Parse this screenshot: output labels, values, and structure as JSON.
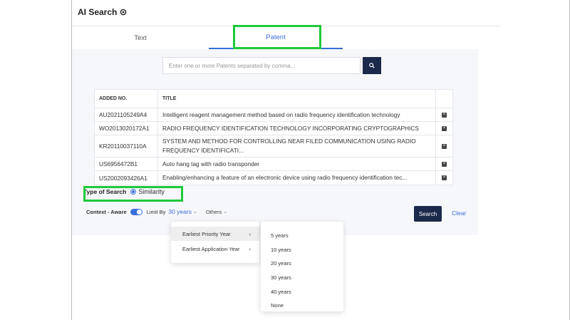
{
  "app": {
    "title": "AI Search"
  },
  "tabs": [
    {
      "label": "Text"
    },
    {
      "label": "Patent"
    }
  ],
  "search": {
    "placeholder": "Enter one or more Patents separated by comma..."
  },
  "table": {
    "headers": [
      "ADDED NO.",
      "TITLE"
    ],
    "rows": [
      {
        "no": "AU2021105249A4",
        "title": "Intelligent reagent management method based on radio frequency identification technology"
      },
      {
        "no": "WO2013020172A1",
        "title": "RADIO FREQUENCY IDENTIFICATION TECHNOLOGY INCORPORATING CRYPTOGRAPHICS"
      },
      {
        "no": "KR20110037110A",
        "title": "SYSTEM AND METHOD FOR CONTROLLING NEAR FILED COMMUNICATION USING RADIO FREQUENCY IDENTIFICATI..."
      },
      {
        "no": "US6956472B1",
        "title": "Auto hang tag with radio transponder"
      },
      {
        "no": "US2002093426A1",
        "title": "Enabling/enhancing a feature of an electronic device using radio frequency identification tec..."
      }
    ]
  },
  "type_of_search": {
    "label": "Type of Search",
    "value": "Similarity"
  },
  "options": {
    "context_label": "Context - Aware",
    "limit_label": "Limit By",
    "limit_value": "30 years",
    "others_label": "Others"
  },
  "actions": {
    "search_label": "Search",
    "clear_label": "Clear"
  },
  "limit_menu": {
    "items": [
      "Earliest Priority Year",
      "Earliest Application Year"
    ],
    "sub_items": [
      "5 years",
      "10 years",
      "20 years",
      "30 years",
      "40 years",
      "None"
    ]
  },
  "colors": {
    "accent": "#3a6fd8",
    "dark": "#1b2a4a",
    "highlight": "#1ec93b"
  }
}
